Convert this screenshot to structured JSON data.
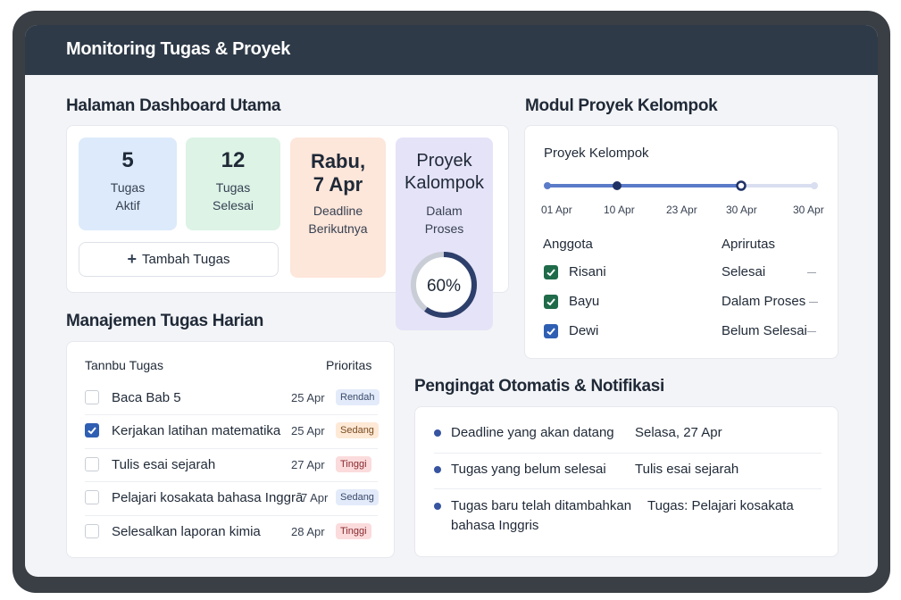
{
  "app_title": "Monitoring Tugas & Proyek",
  "dashboard": {
    "heading": "Halaman Dashboard Utama",
    "tile_active": {
      "value": "5",
      "line1": "Tugas",
      "line2": "Aktif"
    },
    "tile_done": {
      "value": "12",
      "line1": "Tugas",
      "line2": "Selesai"
    },
    "tile_deadline": {
      "line1": "Rabu,",
      "line2": "7 Apr",
      "label1": "Deadline",
      "label2": "Berikutnya"
    },
    "tile_project": {
      "line1": "Proyek",
      "line2": "Kalompok",
      "label1": "Dalam",
      "label2": "Proses",
      "progress_label": "60%",
      "progress": 0.6
    },
    "add_button": "Tambah Tugas"
  },
  "tasks": {
    "heading": "Manajemen Tugas Harian",
    "col_task": "Tannbu Tugas",
    "col_priority": "Prioritas",
    "rows": [
      {
        "name": "Baca Bab 5",
        "date": "25 Apr",
        "priority": "Rendah",
        "checked": false
      },
      {
        "name": "Kerjakan latihan matematika",
        "date": "25 Apr",
        "priority": "Sedang",
        "checked": true
      },
      {
        "name": "Tulis esai sejarah",
        "date": "27 Apr",
        "priority": "Tinggi",
        "checked": false
      },
      {
        "name": "Pelajari kosakata bahasa Inggrā",
        "date": "7 Apr",
        "priority": "Sedang",
        "checked": false
      },
      {
        "name": "Selesalkan laporan kimia",
        "date": "28 Apr",
        "priority": "Tinggi",
        "checked": false
      }
    ]
  },
  "project": {
    "heading": "Modul Proyek Kelompok",
    "card_title": "Proyek Kelompok",
    "timeline": [
      "01 Apr",
      "10 Apr",
      "23 Apr",
      "30 Apr",
      "30 Apr"
    ],
    "col_members": "Anggota",
    "col_priority": "Aprirutas",
    "members": [
      {
        "name": "Risani",
        "status": "Selesai",
        "color": "#1f6b4a"
      },
      {
        "name": "Bayu",
        "status": "Dalam Proses",
        "color": "#1f6b4a"
      },
      {
        "name": "Dewi",
        "status": "Belum Selesai",
        "color": "#2f5fb3"
      }
    ]
  },
  "notifications": {
    "heading": "Pengingat Otomatis & Notifikasi",
    "items": [
      {
        "label": "Deadline yang akan datang",
        "value": "Selasa, 27 Apr"
      },
      {
        "label": "Tugas yang belum selesai",
        "value": "Tulis esai sejarah"
      },
      {
        "label1": "Tugas baru telah ditambahkan",
        "label2": "bahasa Inggris",
        "value": "Tugas: Pelajari kosakata"
      }
    ]
  },
  "colors": {
    "accent": "#2f5fb3",
    "header": "#2e3a48",
    "progress": "#2d3f6b"
  }
}
